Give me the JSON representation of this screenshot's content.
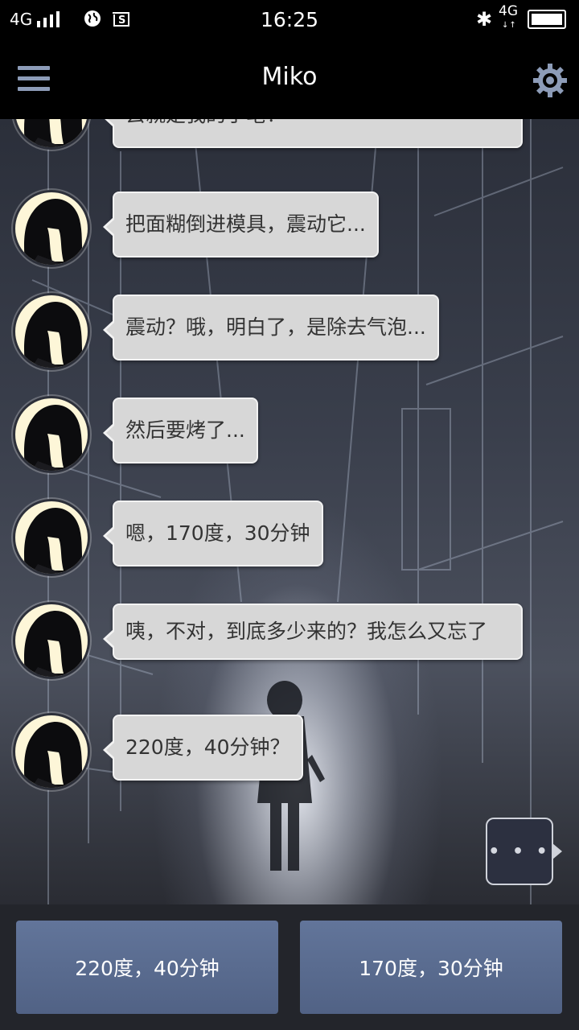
{
  "status_bar": {
    "network": "4G",
    "network_secondary": "4G",
    "time": "16:25",
    "bluetooth_icon": "bluetooth-icon",
    "battery_level": 1.0
  },
  "app_bar": {
    "title": "Miko",
    "menu_icon": "hamburger-menu-icon",
    "settings_icon": "gear-icon"
  },
  "messages": [
    {
      "sender": "Miko",
      "text": "去就是我的手笔！"
    },
    {
      "sender": "Miko",
      "text": "把面糊倒进模具，震动它..."
    },
    {
      "sender": "Miko",
      "text": "震动？哦，明白了，是除去气泡..."
    },
    {
      "sender": "Miko",
      "text": "然后要烤了..."
    },
    {
      "sender": "Miko",
      "text": "嗯，170度，30分钟"
    },
    {
      "sender": "Miko",
      "text": "咦，不对，到底多少来的？我怎么又忘了"
    },
    {
      "sender": "Miko",
      "text": "220度，40分钟？"
    }
  ],
  "typing_indicator": "• • •",
  "choices": [
    {
      "label": "220度，40分钟"
    },
    {
      "label": "170度，30分钟"
    }
  ],
  "colors": {
    "accent": "#8d9cb8",
    "bubble": "#d7d7d7",
    "choice_button": "#5a6b8f",
    "avatar_bg": "#fdf6d8"
  }
}
